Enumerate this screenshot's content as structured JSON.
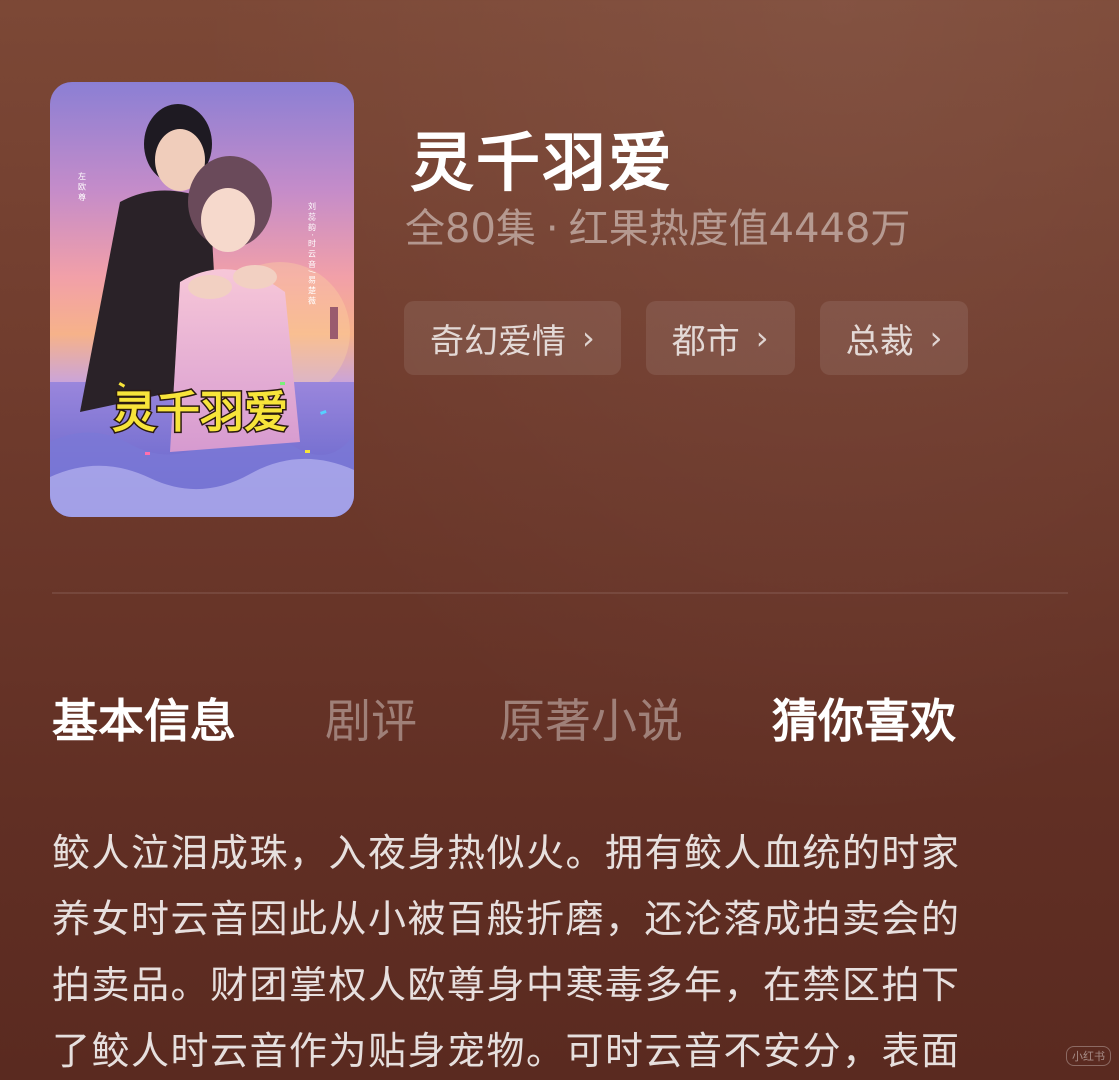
{
  "drama": {
    "title": "灵千羽爱",
    "episodes": "全80集",
    "separator": "·",
    "heat": "红果热度值4448万",
    "poster_title": "灵千羽爱",
    "poster_credit_left": "左 欧 尊",
    "poster_credit_right": "刘 蕊 韵 · 时 云 音 / 易 楚 薇"
  },
  "tags": [
    {
      "label": "奇幻爱情"
    },
    {
      "label": "都市"
    },
    {
      "label": "总裁"
    }
  ],
  "tabs": {
    "basic_info": "基本信息",
    "review": "剧评",
    "novel": "原著小说",
    "guess": "猜你喜欢"
  },
  "description": {
    "lines": [
      "鲛人泣泪成珠，入夜身热似火。拥有鲛人血统的时家",
      "养女时云音因此从小被百般折磨，还沦落成拍卖会的",
      "拍卖品。财团掌权人欧尊身中寒毒多年，在禁区拍下",
      "了鲛人时云音作为贴身宠物。可时云音不安分，表面"
    ]
  },
  "watermark": "小红书",
  "icons": {
    "chevron": "chevron-right-icon"
  },
  "colors": {
    "background_top": "#7c4836",
    "background_bottom": "#5a2a20",
    "poster_title_yellow": "#f7e43a"
  }
}
